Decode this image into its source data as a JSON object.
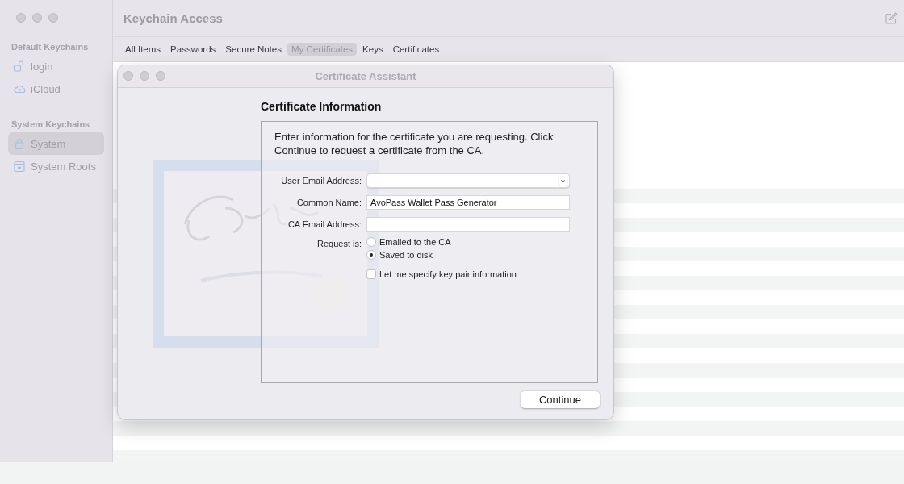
{
  "window": {
    "title": "Keychain Access"
  },
  "sidebar": {
    "sections": [
      {
        "heading": "Default Keychains",
        "items": [
          {
            "label": "login",
            "kind": "unlocked",
            "selected": false
          },
          {
            "label": "iCloud",
            "kind": "cloud",
            "selected": false
          }
        ]
      },
      {
        "heading": "System Keychains",
        "items": [
          {
            "label": "System",
            "kind": "lock",
            "selected": true
          },
          {
            "label": "System Roots",
            "kind": "cabinet",
            "selected": false
          }
        ]
      }
    ]
  },
  "tabs": [
    {
      "label": "All Items",
      "selected": false
    },
    {
      "label": "Passwords",
      "selected": false
    },
    {
      "label": "Secure Notes",
      "selected": false
    },
    {
      "label": "My Certificates",
      "selected": true
    },
    {
      "label": "Keys",
      "selected": false
    },
    {
      "label": "Certificates",
      "selected": false
    }
  ],
  "dialog": {
    "title": "Certificate Assistant",
    "heading": "Certificate Information",
    "intro": "Enter information for the certificate you are requesting. Click Continue to request a certificate from the CA.",
    "fields": [
      {
        "label": "User Email Address:",
        "kind": "popup"
      },
      {
        "label": "Common Name:",
        "kind": "text",
        "value": "AvoPass Wallet Pass Generator"
      },
      {
        "label": "CA Email Address:",
        "kind": "text"
      }
    ],
    "request": {
      "label": "Request is:",
      "options": [
        {
          "label": "Emailed to the CA",
          "selected": false
        },
        {
          "label": "Saved to disk",
          "selected": true
        }
      ]
    },
    "checkbox": {
      "label": "Let me specify key pair information",
      "checked": false
    },
    "button": "Continue"
  }
}
